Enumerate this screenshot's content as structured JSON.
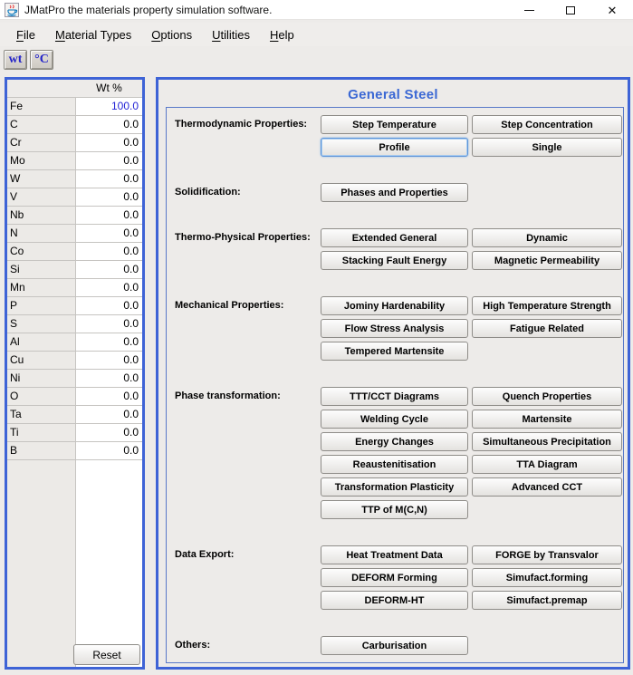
{
  "window": {
    "title": "JMatPro the materials property simulation software.",
    "icon": "java-coffee-cup",
    "controls": {
      "minimize": "minimize",
      "maximize": "maximize",
      "close": "close"
    }
  },
  "menu": {
    "items": [
      {
        "label": "File",
        "mnemonic": "F"
      },
      {
        "label": "Material Types",
        "mnemonic": "M"
      },
      {
        "label": "Options",
        "mnemonic": "O"
      },
      {
        "label": "Utilities",
        "mnemonic": "U"
      },
      {
        "label": "Help",
        "mnemonic": "H"
      }
    ]
  },
  "toolbar": {
    "buttons": [
      {
        "label": "wt",
        "name": "weight-percent-button"
      },
      {
        "label": "°C",
        "name": "celsius-button"
      }
    ]
  },
  "composition": {
    "column_header": "Wt %",
    "reset_label": "Reset",
    "rows": [
      {
        "element": "Fe",
        "value": "100.0",
        "highlighted": true
      },
      {
        "element": "C",
        "value": "0.0",
        "highlighted": false
      },
      {
        "element": "Cr",
        "value": "0.0",
        "highlighted": false
      },
      {
        "element": "Mo",
        "value": "0.0",
        "highlighted": false
      },
      {
        "element": "W",
        "value": "0.0",
        "highlighted": false
      },
      {
        "element": "V",
        "value": "0.0",
        "highlighted": false
      },
      {
        "element": "Nb",
        "value": "0.0",
        "highlighted": false
      },
      {
        "element": "N",
        "value": "0.0",
        "highlighted": false
      },
      {
        "element": "Co",
        "value": "0.0",
        "highlighted": false
      },
      {
        "element": "Si",
        "value": "0.0",
        "highlighted": false
      },
      {
        "element": "Mn",
        "value": "0.0",
        "highlighted": false
      },
      {
        "element": "P",
        "value": "0.0",
        "highlighted": false
      },
      {
        "element": "S",
        "value": "0.0",
        "highlighted": false
      },
      {
        "element": "Al",
        "value": "0.0",
        "highlighted": false
      },
      {
        "element": "Cu",
        "value": "0.0",
        "highlighted": false
      },
      {
        "element": "Ni",
        "value": "0.0",
        "highlighted": false
      },
      {
        "element": "O",
        "value": "0.0",
        "highlighted": false
      },
      {
        "element": "Ta",
        "value": "0.0",
        "highlighted": false
      },
      {
        "element": "Ti",
        "value": "0.0",
        "highlighted": false
      },
      {
        "element": "B",
        "value": "0.0",
        "highlighted": false
      }
    ]
  },
  "main": {
    "title": "General Steel",
    "focused_button": "Profile",
    "sections": [
      {
        "label": "Thermodynamic Properties:",
        "rows": [
          [
            "Step Temperature",
            "Step Concentration"
          ],
          [
            "Profile",
            "Single"
          ]
        ]
      },
      {
        "label": "Solidification:",
        "rows": [
          [
            "Phases and Properties"
          ]
        ]
      },
      {
        "label": "Thermo-Physical Properties:",
        "rows": [
          [
            "Extended General",
            "Dynamic"
          ],
          [
            "Stacking Fault Energy",
            "Magnetic Permeability"
          ]
        ]
      },
      {
        "label": "Mechanical Properties:",
        "rows": [
          [
            "Jominy Hardenability",
            "High Temperature Strength"
          ],
          [
            "Flow Stress Analysis",
            "Fatigue Related"
          ],
          [
            "Tempered Martensite"
          ]
        ]
      },
      {
        "label": "Phase transformation:",
        "rows": [
          [
            "TTT/CCT Diagrams",
            "Quench Properties"
          ],
          [
            "Welding Cycle",
            "Martensite"
          ],
          [
            "Energy Changes",
            "Simultaneous Precipitation"
          ],
          [
            "Reaustenitisation",
            "TTA Diagram"
          ],
          [
            "Transformation Plasticity",
            "Advanced CCT"
          ],
          [
            "TTP of M(C,N)"
          ]
        ]
      },
      {
        "label": "Data Export:",
        "rows": [
          [
            "Heat Treatment Data",
            "FORGE by Transvalor"
          ],
          [
            "DEFORM Forming",
            "Simufact.forming"
          ],
          [
            "DEFORM-HT",
            "Simufact.premap"
          ]
        ]
      },
      {
        "label": "Others:",
        "rows": [
          [
            "Carburisation"
          ]
        ]
      }
    ]
  },
  "colors": {
    "panel_border": "#3e63d6",
    "panel_title": "#3b68d4",
    "highlight_value": "#2424d6",
    "toolbar_text": "#2323c8"
  }
}
